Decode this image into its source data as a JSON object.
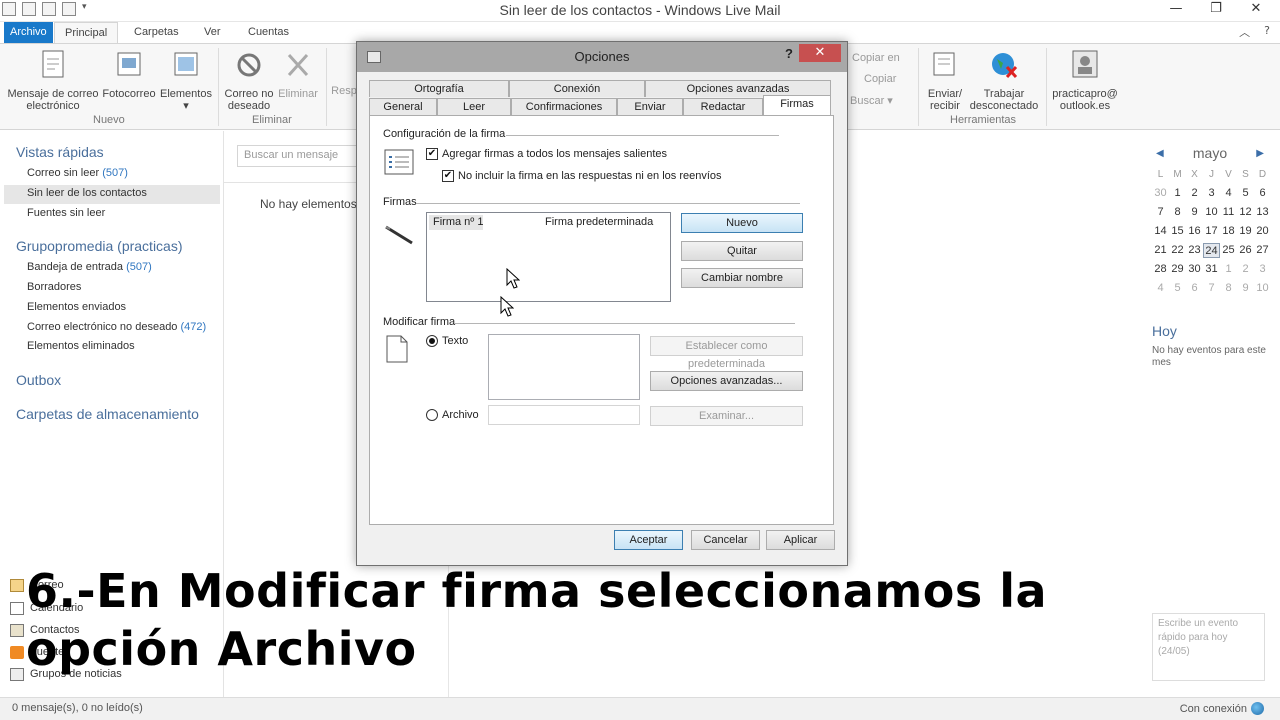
{
  "window": {
    "title": "Sin leer de los contactos - Windows Live Mail"
  },
  "ribbon_tabs": [
    "Archivo",
    "Principal",
    "Carpetas",
    "Ver",
    "Cuentas"
  ],
  "ribbon": {
    "new_mail": "Mensaje de correo electrónico",
    "photo_mail": "Fotocorreo",
    "items": "Elementos",
    "group_new": "Nuevo",
    "junk": "Correo no deseado",
    "delete": "Eliminar",
    "reply": "Resp",
    "group_delete": "Eliminar",
    "copy_to": "Copiar en",
    "copy": "Copiar",
    "find": "Buscar",
    "send_receive": "Enviar/ recibir",
    "work_offline": "Trabajar desconectado",
    "account": "practicapro@ outlook.es",
    "group_tools": "Herramientas"
  },
  "nav": {
    "quick_views": "Vistas rápidas",
    "unread_mail": "Correo sin leer",
    "unread_mail_count": "(507)",
    "unread_contacts": "Sin leer de los contactos",
    "unread_feeds": "Fuentes sin leer",
    "account": "Grupopromedia (practicas)",
    "inbox": "Bandeja de entrada",
    "inbox_count": "(507)",
    "drafts": "Borradores",
    "sent": "Elementos enviados",
    "junk": "Correo electrónico no deseado",
    "junk_count": "(472)",
    "deleted": "Elementos eliminados",
    "outbox": "Outbox",
    "storage": "Carpetas de almacenamiento",
    "bottom": [
      "Correo",
      "Calendario",
      "Contactos",
      "Fuentes",
      "Grupos de noticias"
    ]
  },
  "middle": {
    "search_placeholder": "Buscar un mensaje",
    "empty": "No hay elementos e"
  },
  "calendar": {
    "month": "mayo",
    "dow": [
      "L",
      "M",
      "X",
      "J",
      "V",
      "S",
      "D"
    ],
    "weeks": [
      [
        "30",
        "1",
        "2",
        "3",
        "4",
        "5",
        "6"
      ],
      [
        "7",
        "8",
        "9",
        "10",
        "11",
        "12",
        "13"
      ],
      [
        "14",
        "15",
        "16",
        "17",
        "18",
        "19",
        "20"
      ],
      [
        "21",
        "22",
        "23",
        "24",
        "25",
        "26",
        "27"
      ],
      [
        "28",
        "29",
        "30",
        "31",
        "1",
        "2",
        "3"
      ],
      [
        "4",
        "5",
        "6",
        "7",
        "8",
        "9",
        "10"
      ]
    ],
    "today": "Hoy",
    "no_events": "No hay eventos para este mes",
    "quick_event": "Escribe un evento rápido para hoy (24/05)"
  },
  "status": {
    "left": "0 mensaje(s), 0 no leído(s)",
    "right": "Con conexión"
  },
  "dialog": {
    "title": "Opciones",
    "help": "?",
    "close": "✕",
    "tabs_back": [
      "Ortografía",
      "Conexión",
      "Opciones avanzadas"
    ],
    "tabs_front": [
      "General",
      "Leer",
      "Confirmaciones",
      "Enviar",
      "Redactar",
      "Firmas"
    ],
    "config_label": "Configuración de la firma",
    "add_sig_all": "Agregar firmas a todos los mensajes salientes",
    "no_sig_replies": "No incluir la firma en las respuestas ni en los reenvíos",
    "firmas_label": "Firmas",
    "sig_name": "Firma nº 1",
    "sig_default": "Firma predeterminada",
    "btn_new": "Nuevo",
    "btn_remove": "Quitar",
    "btn_rename": "Cambiar nombre",
    "modify_label": "Modificar firma",
    "radio_text": "Texto",
    "radio_file": "Archivo",
    "btn_set_default": "Establecer como predeterminada",
    "btn_advanced": "Opciones avanzadas...",
    "btn_browse": "Examinar...",
    "btn_ok": "Aceptar",
    "btn_cancel": "Cancelar",
    "btn_apply": "Aplicar"
  },
  "caption": "6.-En Modificar firma seleccionamos la opción Archivo",
  "colors": {
    "accent": "#1979ca",
    "nav_header": "#4a6f9c",
    "close": "#c75050"
  }
}
